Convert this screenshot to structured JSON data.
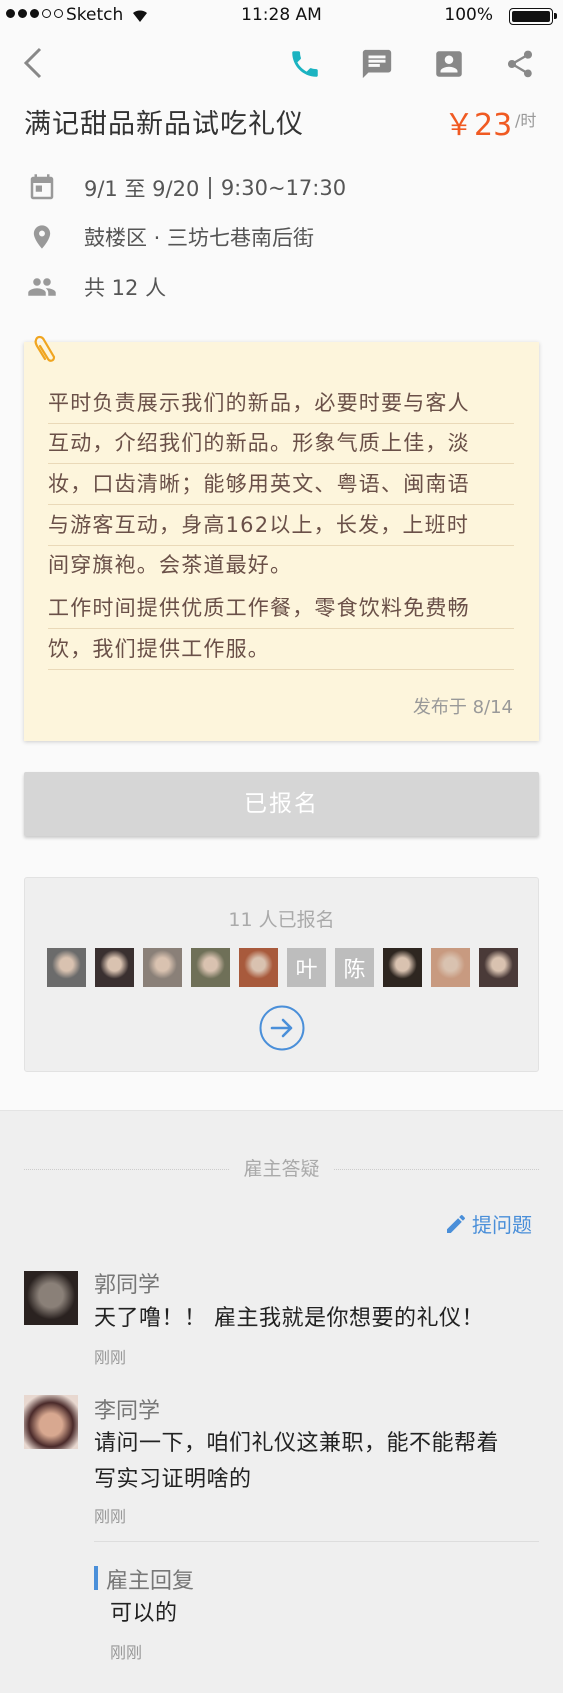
{
  "status_bar": {
    "carrier": "Sketch",
    "time": "11:28 AM",
    "battery": "100%"
  },
  "nav": {
    "back_icon": "chevron-left-icon",
    "phone_icon": "phone-icon",
    "message_icon": "chat-icon",
    "contact_icon": "contact-card-icon",
    "share_icon": "share-icon",
    "phone_color": "#1bb3c1"
  },
  "job": {
    "title": "满记甜品新品试吃礼仪",
    "price": "￥23",
    "unit": "/时",
    "date": "9/1 至 9/20",
    "time": "9:30~17:30",
    "location": "鼓楼区 · 三坊七巷南后街",
    "headcount": "共 12 人"
  },
  "description": {
    "lines": [
      "平时负责展示我们的新品，必要时要与客人",
      "互动，介绍我们的新品。形象气质上佳，淡",
      "妆，口齿清晰；能够用英文、粤语、闽南语",
      "与游客互动，身高162以上，长发，上班时",
      "间穿旗袍。会茶道最好。",
      "工作时间提供优质工作餐，零食饮料免费畅",
      "饮，我们提供工作服。"
    ],
    "posted": "发布于 8/14"
  },
  "signup_button": "已报名",
  "applicants": {
    "count_text": "11 人已报名",
    "avatars": [
      {
        "type": "photo",
        "color": "#6b6b6b"
      },
      {
        "type": "photo",
        "color": "#3a3030"
      },
      {
        "type": "photo",
        "color": "#8a8078"
      },
      {
        "type": "photo",
        "color": "#6f7058"
      },
      {
        "type": "photo",
        "color": "#a85a3c"
      },
      {
        "type": "text",
        "text": "叶",
        "color": "#bdbdbd"
      },
      {
        "type": "text",
        "text": "陈",
        "color": "#bdbdbd"
      },
      {
        "type": "photo",
        "color": "#2e2620"
      },
      {
        "type": "photo",
        "color": "#c89a80"
      },
      {
        "type": "photo",
        "color": "#4a3a38"
      }
    ]
  },
  "qa": {
    "heading": "雇主答疑",
    "ask_label": "提问题",
    "comments": [
      {
        "name": "郭同学",
        "text": "天了噜！！ 雇主我就是你想要的礼仪！",
        "time": "刚刚"
      },
      {
        "name": "李同学",
        "text_lines": [
          "请问一下，咱们礼仪这兼职，能不能帮着",
          "写实习证明啥的"
        ],
        "time": "刚刚"
      }
    ],
    "reply": {
      "label": "雇主回复",
      "text": "可以的",
      "time": "刚刚"
    }
  },
  "colors": {
    "accent": "#f05a22",
    "link": "#4a8fd9",
    "note_bg": "#fdf5dc"
  }
}
